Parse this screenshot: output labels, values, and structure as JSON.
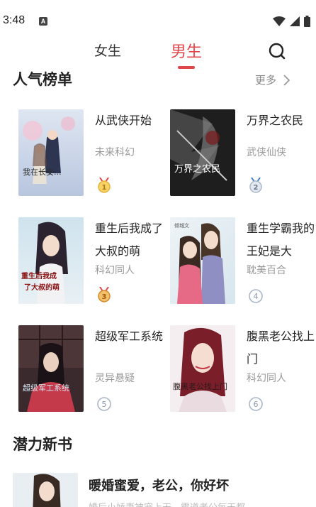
{
  "status_bar": {
    "time": "3:48",
    "notification_letter": "A"
  },
  "tabs": [
    {
      "label": "女生"
    },
    {
      "label": "男生"
    }
  ],
  "ranking": {
    "title": "人气榜单",
    "more_label": "更多",
    "books": [
      {
        "title": "从武侠开始",
        "genre": "未来科幻",
        "rank": "1",
        "cover_text": "我在长安..."
      },
      {
        "title": "万界之农民",
        "genre": "武侠仙侠",
        "rank": "2",
        "cover_text": "万界之农民"
      },
      {
        "title": "重生后我成了大叔的萌",
        "genre": "科幻同人",
        "rank": "3",
        "cover_text": "重生后我成了大叔的萌"
      },
      {
        "title": "重生学霸我的王妃是大",
        "genre": "耽美百合",
        "rank": "4",
        "cover_text": ""
      },
      {
        "title": "超级军工系统",
        "genre": "灵异悬疑",
        "rank": "5",
        "cover_text": "超级军工系统"
      },
      {
        "title": "腹黑老公找上门",
        "genre": "科幻同人",
        "rank": "6",
        "cover_text": "腹黑老公找上门"
      }
    ]
  },
  "potential": {
    "title": "潜力新书",
    "featured": {
      "title": "暖婚蜜爱，老公，你好坏",
      "description": "婚后小娇妻被宠上天，霸道老公每天都..."
    }
  },
  "colors": {
    "accent": "#e0454a",
    "gold": "#e8b23a",
    "silver": "#a9b7c8"
  }
}
